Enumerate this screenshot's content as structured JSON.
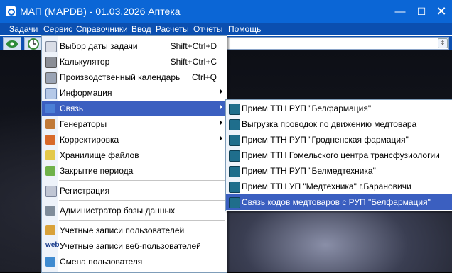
{
  "window": {
    "title": "МАП (MAPDB) - 01.03.2026 Аптека",
    "minimize_glyph": "—",
    "maximize_glyph": "☐",
    "close_glyph": "✕"
  },
  "menubar": {
    "items": [
      "Задачи",
      "Сервис",
      "Справочники",
      "Ввод",
      "Расчеты",
      "Отчеты",
      "Помощь"
    ],
    "active": "Сервис"
  },
  "toolbar": {
    "buttons": [
      "eye-icon",
      "clock-icon"
    ],
    "combo_arrow": "⇕"
  },
  "service_menu": {
    "items": [
      {
        "label": "Выбор даты задачи",
        "shortcut": "Shift+Ctrl+D",
        "icon": "calendar-icon"
      },
      {
        "label": "Калькулятор",
        "shortcut": "Shift+Ctrl+C",
        "icon": "calculator-icon"
      },
      {
        "label": "Производственный календарь",
        "shortcut": "Ctrl+Q",
        "icon": "production-calendar-icon"
      },
      {
        "label": "Информация",
        "submenu": true,
        "icon": "info-icon"
      },
      {
        "label": "Связь",
        "submenu": true,
        "highlighted": true,
        "icon": "link-icon"
      },
      {
        "label": "Генераторы",
        "submenu": true,
        "icon": "generator-icon"
      },
      {
        "label": "Корректировка",
        "submenu": true,
        "icon": "correction-icon"
      },
      {
        "label": "Хранилище файлов",
        "icon": "file-storage-icon"
      },
      {
        "label": "Закрытие периода",
        "icon": "period-close-icon"
      },
      {
        "label": "Регистрация",
        "icon": "registration-icon"
      },
      {
        "label": "Администратор базы данных",
        "icon": "db-admin-icon"
      },
      {
        "label": "Учетные записи пользователей",
        "icon": "users-icon"
      },
      {
        "label": "Учетные записи веб-пользователей",
        "icon": "web-users-icon",
        "icon_text": "web"
      },
      {
        "label": "Смена пользователя",
        "icon": "change-user-icon"
      }
    ]
  },
  "link_submenu": {
    "items": [
      {
        "label": "Прием ТТН РУП \"Белфармация\""
      },
      {
        "label": "Выгрузка проводок по движению медтовара"
      },
      {
        "label": "Прием ТТН РУП \"Гродненская фармация\""
      },
      {
        "label": "Прием ТТН Гомельского центра трансфузиологии"
      },
      {
        "label": "Прием ТТН РУП \"Белмедтехника\""
      },
      {
        "label": "Прием ТТН УП \"Медтехника\" г.Барановичи"
      },
      {
        "label": "Связь кодов медтоваров с РУП \"Белфармация\"",
        "highlighted": true
      }
    ]
  }
}
